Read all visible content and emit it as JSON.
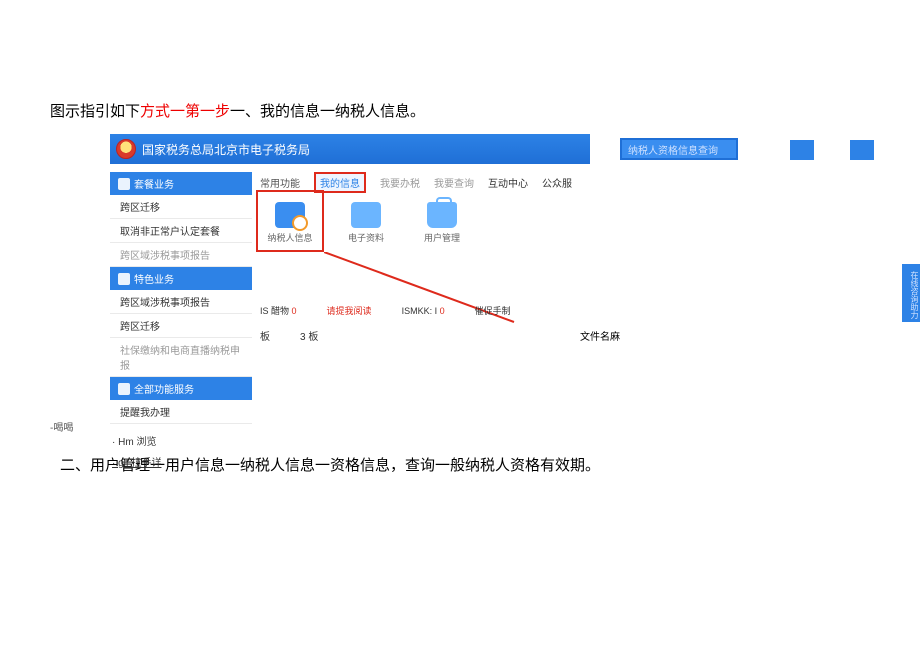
{
  "step1": {
    "prefix": "图示指引如下",
    "highlight": "方式一第一步",
    "suffix": "一、我的信息一纳税人信息。"
  },
  "header": {
    "title": "国家税务总局北京市电子税务局"
  },
  "search": {
    "placeholder": "纳税人资格信息查询"
  },
  "sidebar": {
    "group1_title": "套餐业务",
    "group1_items": [
      "跨区迁移",
      "取消非正常户认定套餐",
      "跨区域涉税事项报告"
    ],
    "group2_title": "特色业务",
    "group2_items": [
      "跨区域涉税事项报告",
      "跨区迁移",
      "社保缴纳和电商直播纳税申报"
    ],
    "group3_title": "全部功能服务",
    "group3_items": [
      "提醒我办理"
    ],
    "sublist": [
      "· Hm 浏览",
      "· gif 拉手详"
    ],
    "footnote": "-喝喝"
  },
  "tabs": {
    "t1": "常用功能",
    "t2": "我的信息",
    "t3": "我要办税",
    "t4": "我要查询",
    "t5": "互动中心",
    "t6": "公众服"
  },
  "icons": {
    "i1": "纳税人信息",
    "i2": "电子资料",
    "i3": "用户管理"
  },
  "status": {
    "s1a": "IS 醋物",
    "s1b": "0",
    "s2": "请提我阅读",
    "s3a": "ISMKK: I",
    "s3b": "0",
    "s4": "催促手制"
  },
  "files": {
    "f1": "板",
    "f2": "3 板",
    "label": "文件名麻"
  },
  "rightTab": "在线咨询助力",
  "step2": "二、用户管理一用户信息一纳税人信息一资格信息，查询一般纳税人资格有效期。"
}
